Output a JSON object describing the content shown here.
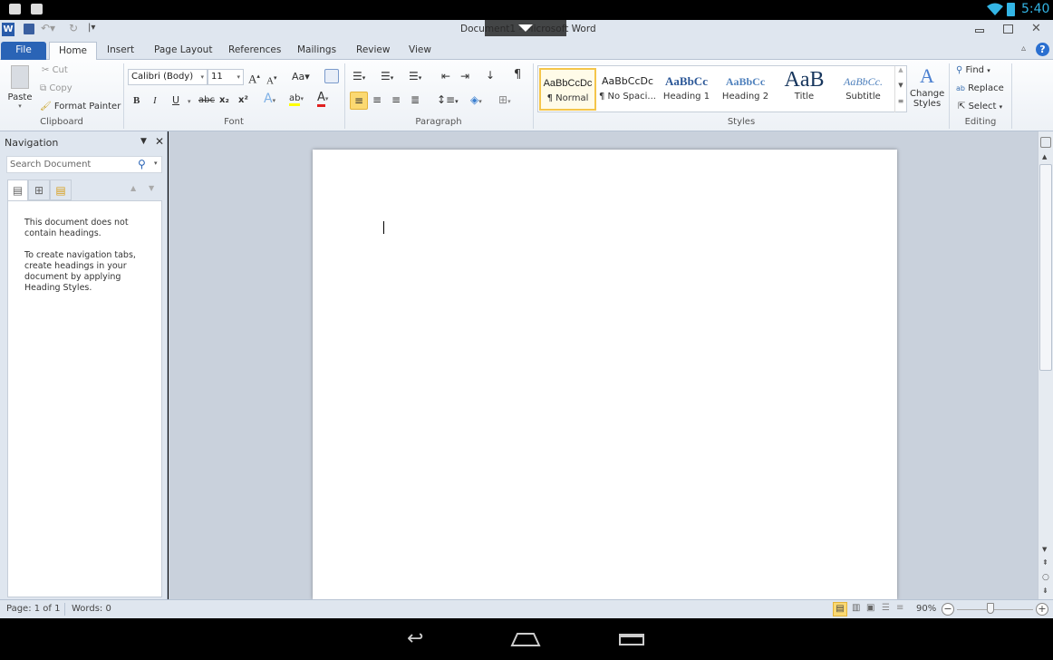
{
  "system": {
    "time": "5:40",
    "icons": [
      "briefcase-icon",
      "bag-icon",
      "wifi-icon",
      "battery-icon"
    ]
  },
  "window": {
    "title": "Document1 - Microsoft Word",
    "controls": [
      "minimize",
      "restore",
      "close"
    ]
  },
  "tabs": [
    {
      "label": "File"
    },
    {
      "label": "Home",
      "active": true
    },
    {
      "label": "Insert"
    },
    {
      "label": "Page Layout"
    },
    {
      "label": "References"
    },
    {
      "label": "Mailings"
    },
    {
      "label": "Review"
    },
    {
      "label": "View"
    }
  ],
  "ribbon": {
    "clipboard": {
      "label": "Clipboard",
      "paste": "Paste",
      "cut": "Cut",
      "copy": "Copy",
      "format_painter": "Format Painter"
    },
    "font": {
      "label": "Font",
      "font_name": "Calibri (Body)",
      "font_size": "11",
      "change_case": "Aa",
      "bold": "B",
      "italic": "I",
      "underline": "U",
      "strike": "abc",
      "subscript": "x₂",
      "superscript": "x²",
      "font_color_hex": "#e02020",
      "highlight_hex": "#ffff00"
    },
    "paragraph": {
      "label": "Paragraph",
      "pilcrow": "¶"
    },
    "styles": {
      "label": "Styles",
      "items": [
        {
          "preview": "AaBbCcDc",
          "name": "¶ Normal",
          "selected": true
        },
        {
          "preview": "AaBbCcDc",
          "name": "¶ No Spaci..."
        },
        {
          "preview": "AaBbCc",
          "name": "Heading 1"
        },
        {
          "preview": "AaBbCc",
          "name": "Heading 2"
        },
        {
          "preview": "AaB",
          "name": "Title"
        },
        {
          "preview": "AaBbCc.",
          "name": "Subtitle"
        }
      ],
      "change_styles": "Change Styles"
    },
    "editing": {
      "label": "Editing",
      "find": "Find",
      "replace": "Replace",
      "select": "Select"
    }
  },
  "navigation": {
    "title": "Navigation",
    "search_placeholder": "Search Document",
    "message1": "This document does not contain headings.",
    "message2": "To create navigation tabs, create headings in your document by applying Heading Styles."
  },
  "status": {
    "page": "Page: 1 of 1",
    "words": "Words: 0",
    "zoom": "90%",
    "zoom_percent": 90
  }
}
